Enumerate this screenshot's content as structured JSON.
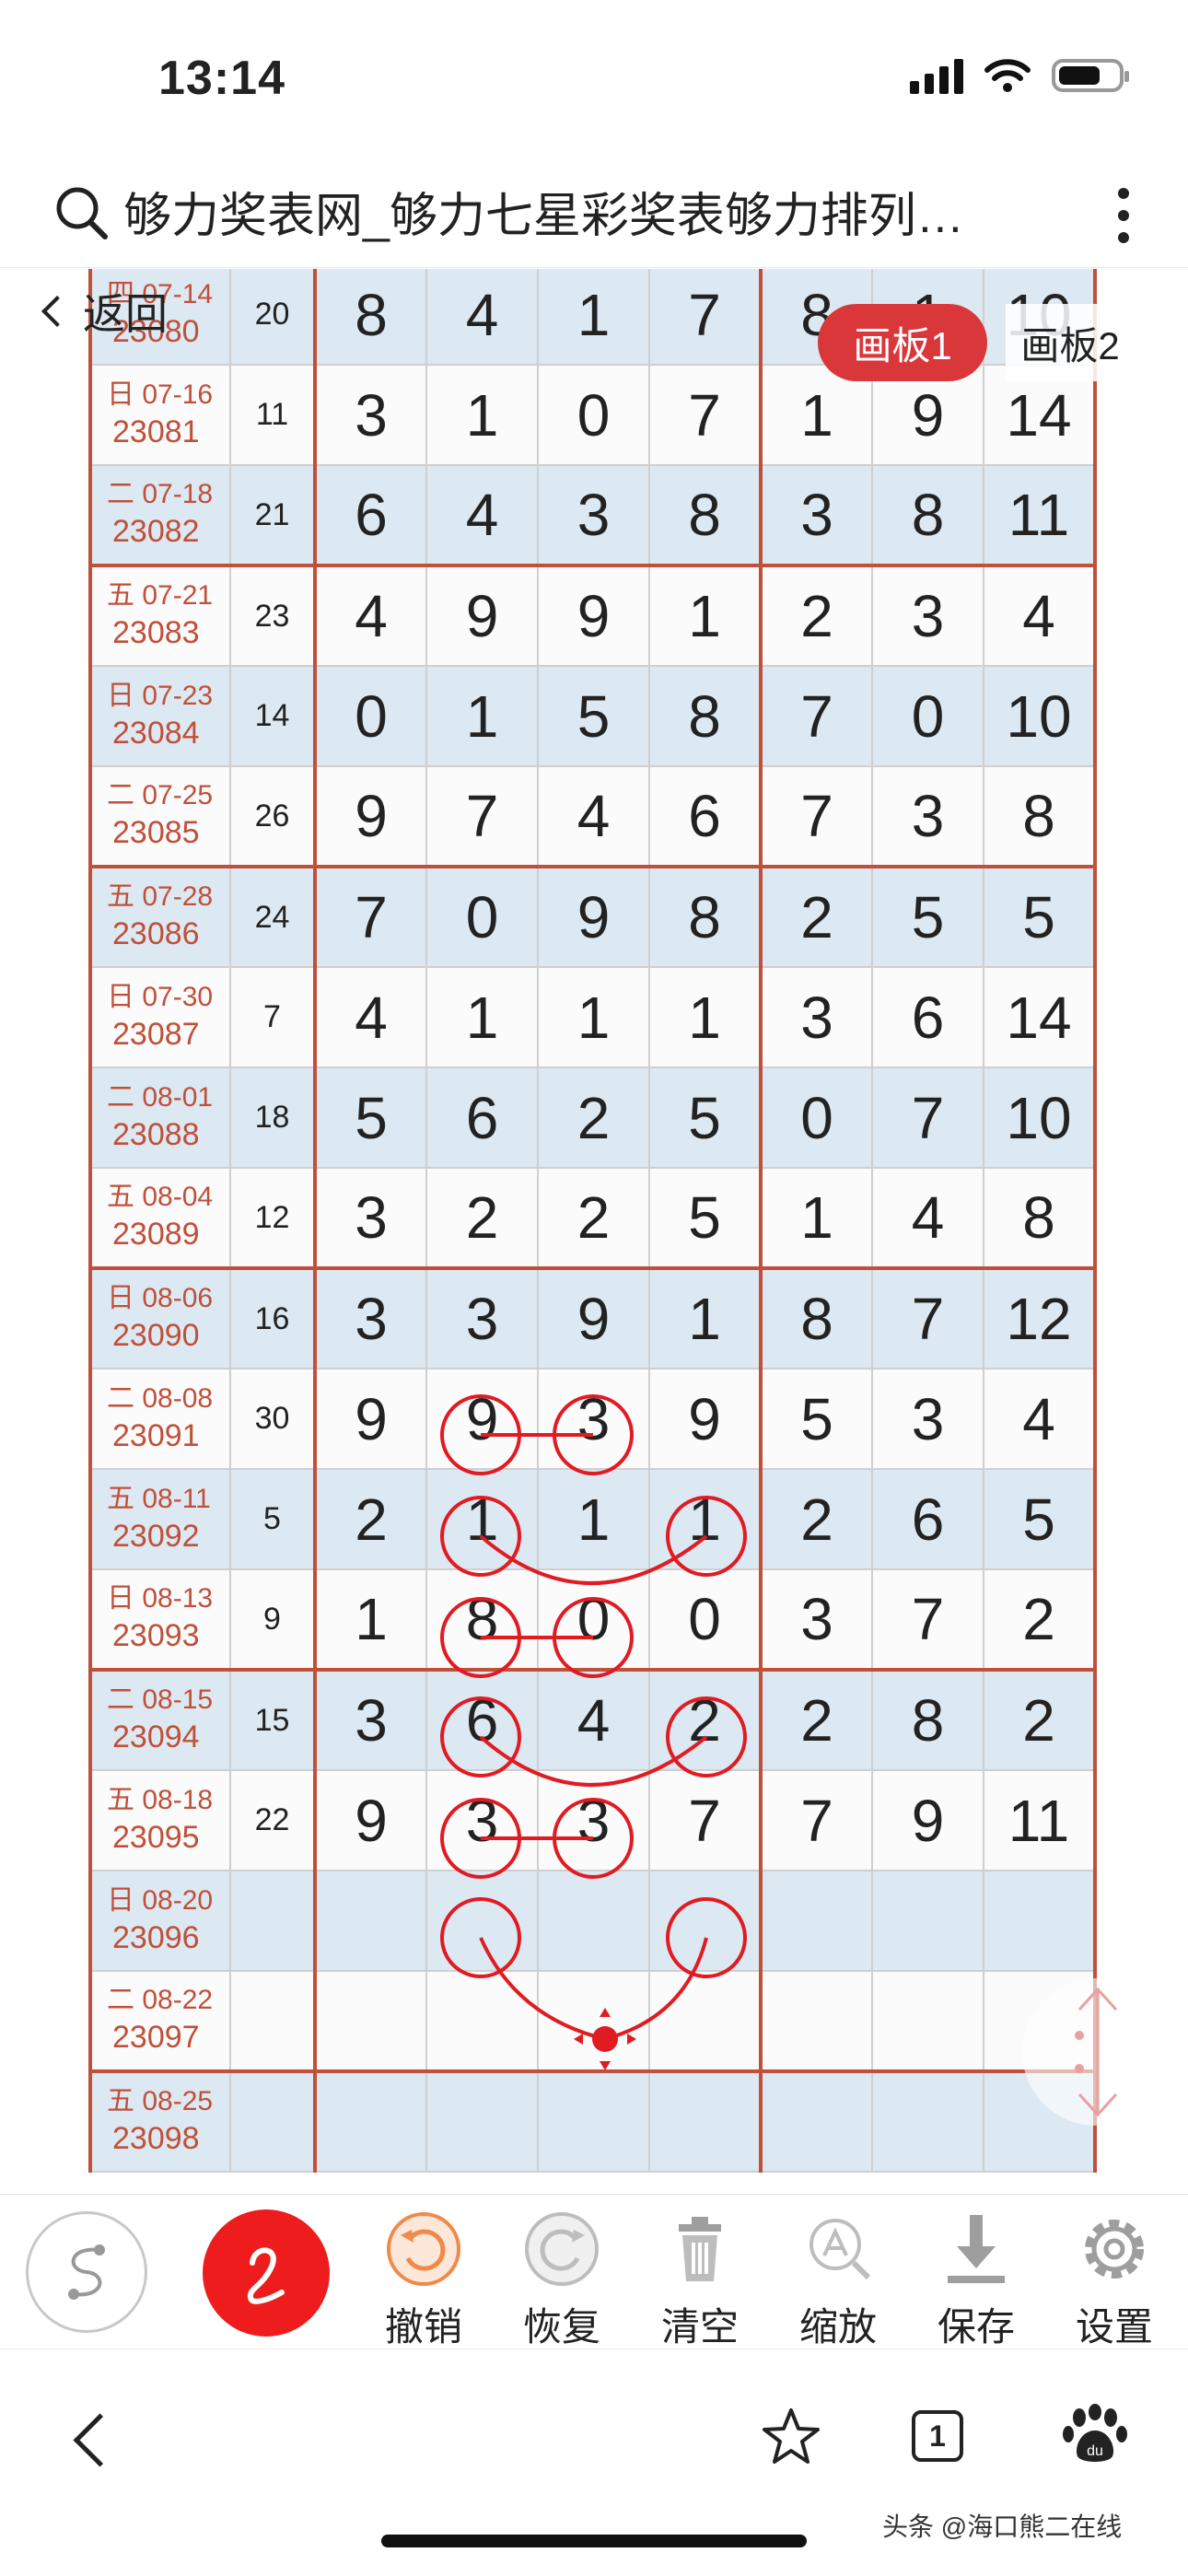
{
  "status": {
    "time": "13:14"
  },
  "browser": {
    "title": "够力奖表网_够力七星彩奖表够力排列…"
  },
  "page": {
    "back_label": "返回",
    "tabs": [
      {
        "label": "画板1",
        "active": true
      },
      {
        "label": "画板2",
        "active": false
      }
    ]
  },
  "table": {
    "rows": [
      {
        "date": "四 07-14",
        "issue": "23080",
        "sum": "20",
        "nums": [
          "8",
          "4",
          "1",
          "7",
          "8",
          "1",
          "10"
        ]
      },
      {
        "date": "日 07-16",
        "issue": "23081",
        "sum": "11",
        "nums": [
          "3",
          "1",
          "0",
          "7",
          "1",
          "9",
          "14"
        ]
      },
      {
        "date": "二 07-18",
        "issue": "23082",
        "sum": "21",
        "nums": [
          "6",
          "4",
          "3",
          "8",
          "3",
          "8",
          "11"
        ]
      },
      {
        "date": "五 07-21",
        "issue": "23083",
        "sum": "23",
        "nums": [
          "4",
          "9",
          "9",
          "1",
          "2",
          "3",
          "4"
        ]
      },
      {
        "date": "日 07-23",
        "issue": "23084",
        "sum": "14",
        "nums": [
          "0",
          "1",
          "5",
          "8",
          "7",
          "0",
          "10"
        ]
      },
      {
        "date": "二 07-25",
        "issue": "23085",
        "sum": "26",
        "nums": [
          "9",
          "7",
          "4",
          "6",
          "7",
          "3",
          "8"
        ]
      },
      {
        "date": "五 07-28",
        "issue": "23086",
        "sum": "24",
        "nums": [
          "7",
          "0",
          "9",
          "8",
          "2",
          "5",
          "5"
        ]
      },
      {
        "date": "日 07-30",
        "issue": "23087",
        "sum": "7",
        "nums": [
          "4",
          "1",
          "1",
          "1",
          "3",
          "6",
          "14"
        ]
      },
      {
        "date": "二 08-01",
        "issue": "23088",
        "sum": "18",
        "nums": [
          "5",
          "6",
          "2",
          "5",
          "0",
          "7",
          "10"
        ]
      },
      {
        "date": "五 08-04",
        "issue": "23089",
        "sum": "12",
        "nums": [
          "3",
          "2",
          "2",
          "5",
          "1",
          "4",
          "8"
        ]
      },
      {
        "date": "日 08-06",
        "issue": "23090",
        "sum": "16",
        "nums": [
          "3",
          "3",
          "9",
          "1",
          "8",
          "7",
          "12"
        ]
      },
      {
        "date": "二 08-08",
        "issue": "23091",
        "sum": "30",
        "nums": [
          "9",
          "9",
          "3",
          "9",
          "5",
          "3",
          "4"
        ]
      },
      {
        "date": "五 08-11",
        "issue": "23092",
        "sum": "5",
        "nums": [
          "2",
          "1",
          "1",
          "1",
          "2",
          "6",
          "5"
        ]
      },
      {
        "date": "日 08-13",
        "issue": "23093",
        "sum": "9",
        "nums": [
          "1",
          "8",
          "0",
          "0",
          "3",
          "7",
          "2"
        ]
      },
      {
        "date": "二 08-15",
        "issue": "23094",
        "sum": "15",
        "nums": [
          "3",
          "6",
          "4",
          "2",
          "2",
          "8",
          "2"
        ]
      },
      {
        "date": "五 08-18",
        "issue": "23095",
        "sum": "22",
        "nums": [
          "9",
          "3",
          "3",
          "7",
          "7",
          "9",
          "11"
        ]
      },
      {
        "date": "日 08-20",
        "issue": "23096",
        "sum": "",
        "nums": [
          "",
          "",
          "",
          "",
          "",
          "",
          ""
        ]
      },
      {
        "date": "二 08-22",
        "issue": "23097",
        "sum": "",
        "nums": [
          "",
          "",
          "",
          "",
          "",
          "",
          ""
        ]
      },
      {
        "date": "五 08-25",
        "issue": "23098",
        "sum": "",
        "nums": [
          "",
          "",
          "",
          "",
          "",
          "",
          ""
        ]
      }
    ]
  },
  "toolbar": {
    "undo": "撤销",
    "redo": "恢复",
    "clear": "清空",
    "zoom": "缩放",
    "save": "保存",
    "settings": "设置"
  },
  "nav": {
    "tab_count": "1"
  },
  "watermark": "头条 @海口熊二在线",
  "colors": {
    "accent_red": "#d9373a",
    "border_red": "#c0503a",
    "row_blue": "#dce9f2",
    "pen_red": "#ee1c1c"
  }
}
